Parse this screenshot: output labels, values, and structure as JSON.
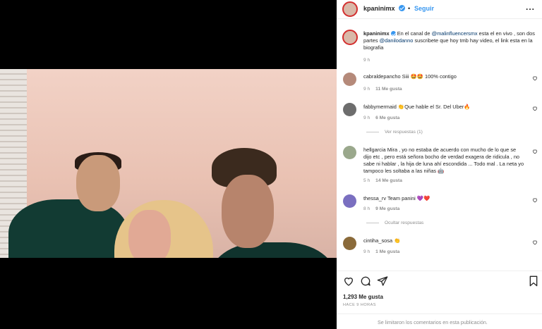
{
  "post": {
    "username": "kpaninimx",
    "dot": "•",
    "follow_label": "Seguir",
    "more_label": "...",
    "caption": {
      "username": "kpaninimx",
      "part1": "En el canal de",
      "mention1": "@malinfluencersmx",
      "part2": "esta el en vivo , son dos partes",
      "mention2": "@danilodanno",
      "part3": "suscribete que hoy tmb hay video, el link esta en la biografia",
      "time": "9 h"
    },
    "comments": [
      {
        "username": "cabraldepancho",
        "text": "Siii 🤩🤩 100% contigo",
        "time": "9 h",
        "likes": "11 Me gusta",
        "replies": ""
      },
      {
        "username": "fabbymermaid",
        "text": "👏Que hable el Sr. Del Uber🔥",
        "time": "9 h",
        "likes": "6 Me gusta",
        "replies": "Ver respuestas (1)"
      },
      {
        "username": "hellgarcia",
        "text": "Mira , yo no estaba de acuerdo con mucho de lo que se dijo etc , pero está señora bocho de verdad exagera de ridicula , no sabe ni hablar , la hija de luna ahí escondida ... Todo mal . La neta yo tampoco les soltaba a las niñas 🤖",
        "time": "5 h",
        "likes": "14 Me gusta",
        "replies": ""
      },
      {
        "username": "thessa_rv",
        "text": "Team panini 💜❤️",
        "time": "8 h",
        "likes": "9 Me gusta",
        "replies": "Ocultar respuestas"
      },
      {
        "username": "cintiha_sosa",
        "text": "👏",
        "time": "9 h",
        "likes": "1 Me gusta",
        "replies": ""
      }
    ],
    "likes_count": "1,293 Me gusta",
    "posted_ago": "HACE 9 HORAS",
    "comments_limited": "Se limitaron los comentarios en esta publicación."
  },
  "colors": {
    "accent": "#3897f0",
    "muted": "#8e8e8e",
    "text": "#262626"
  },
  "icons": [
    "heart-icon",
    "comment-icon",
    "share-icon",
    "bookmark-icon",
    "more-icon",
    "verified-icon"
  ]
}
